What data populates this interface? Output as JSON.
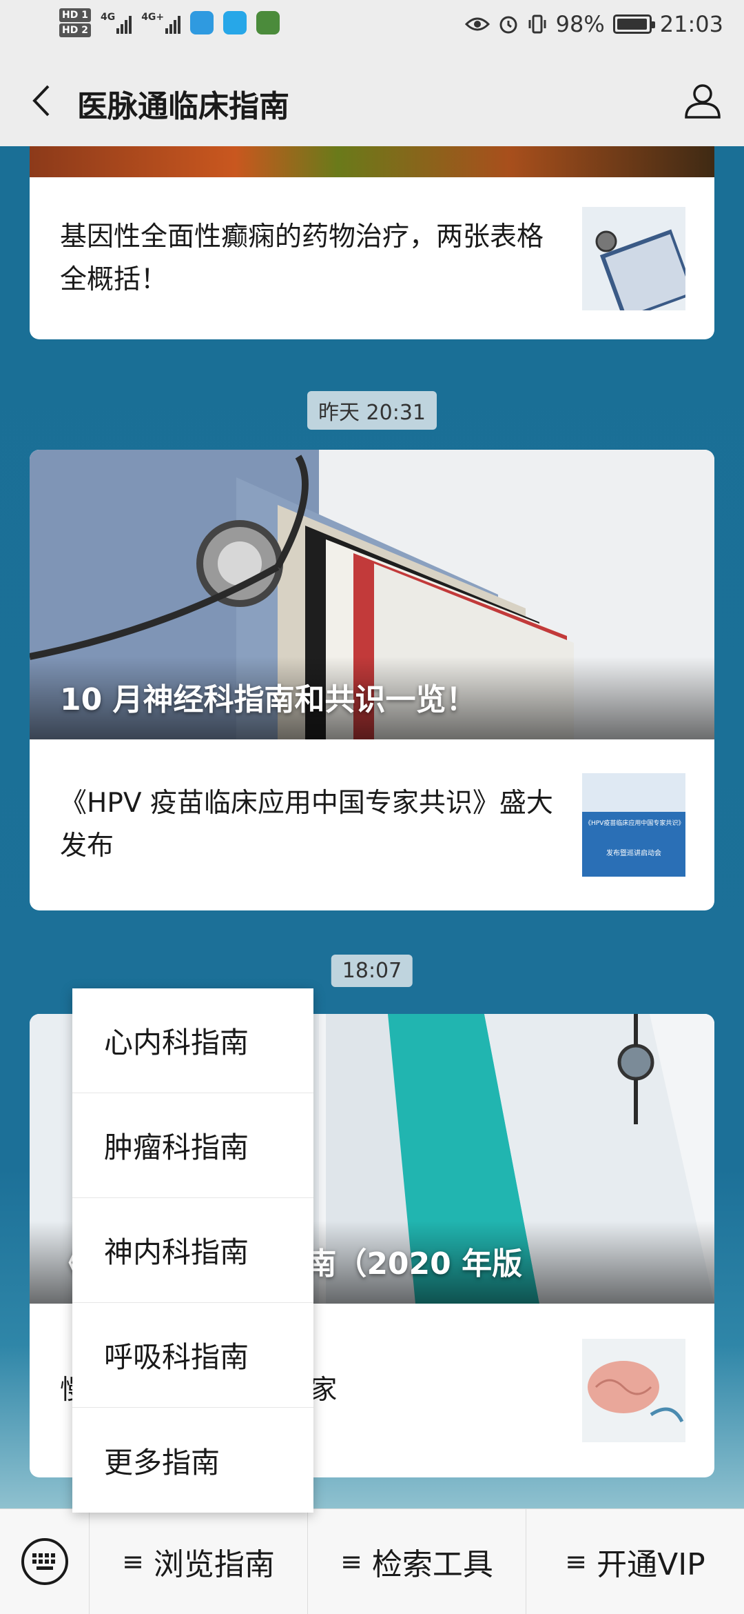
{
  "status_bar": {
    "hd_badges": [
      "HD 1",
      "HD 2"
    ],
    "network_1": "4G",
    "network_2": "4G+",
    "battery_percent": "98%",
    "battery_level": 0.98,
    "time": "21:03"
  },
  "nav": {
    "title": "医脉通临床指南"
  },
  "feed": {
    "card1": {
      "article": "基因性全面性癫痫的药物治疗，两张表格全概括！"
    },
    "time1": "昨天 20:31",
    "card2": {
      "banner_title": "10 月神经科指南和共识一览！",
      "article": "《HPV 疫苗临床应用中国专家共识》盛大发布",
      "thumb_text_1": "《HPV疫苗临床应用中国专家共识》",
      "thumb_text_2": "发布暨巡讲启动会"
    },
    "time2": "18:07",
    "card3": {
      "banner_title": "《                    病诊断与治疗指南（2020 年版",
      "article": "慢              疗？来看看这份专家"
    }
  },
  "menu": {
    "items": [
      "心内科指南",
      "肿瘤科指南",
      "神内科指南",
      "呼吸科指南",
      "更多指南"
    ]
  },
  "bottom_bar": {
    "tabs": [
      "浏览指南",
      "检索工具",
      "开通VIP"
    ],
    "tab_prefix": "≡"
  }
}
